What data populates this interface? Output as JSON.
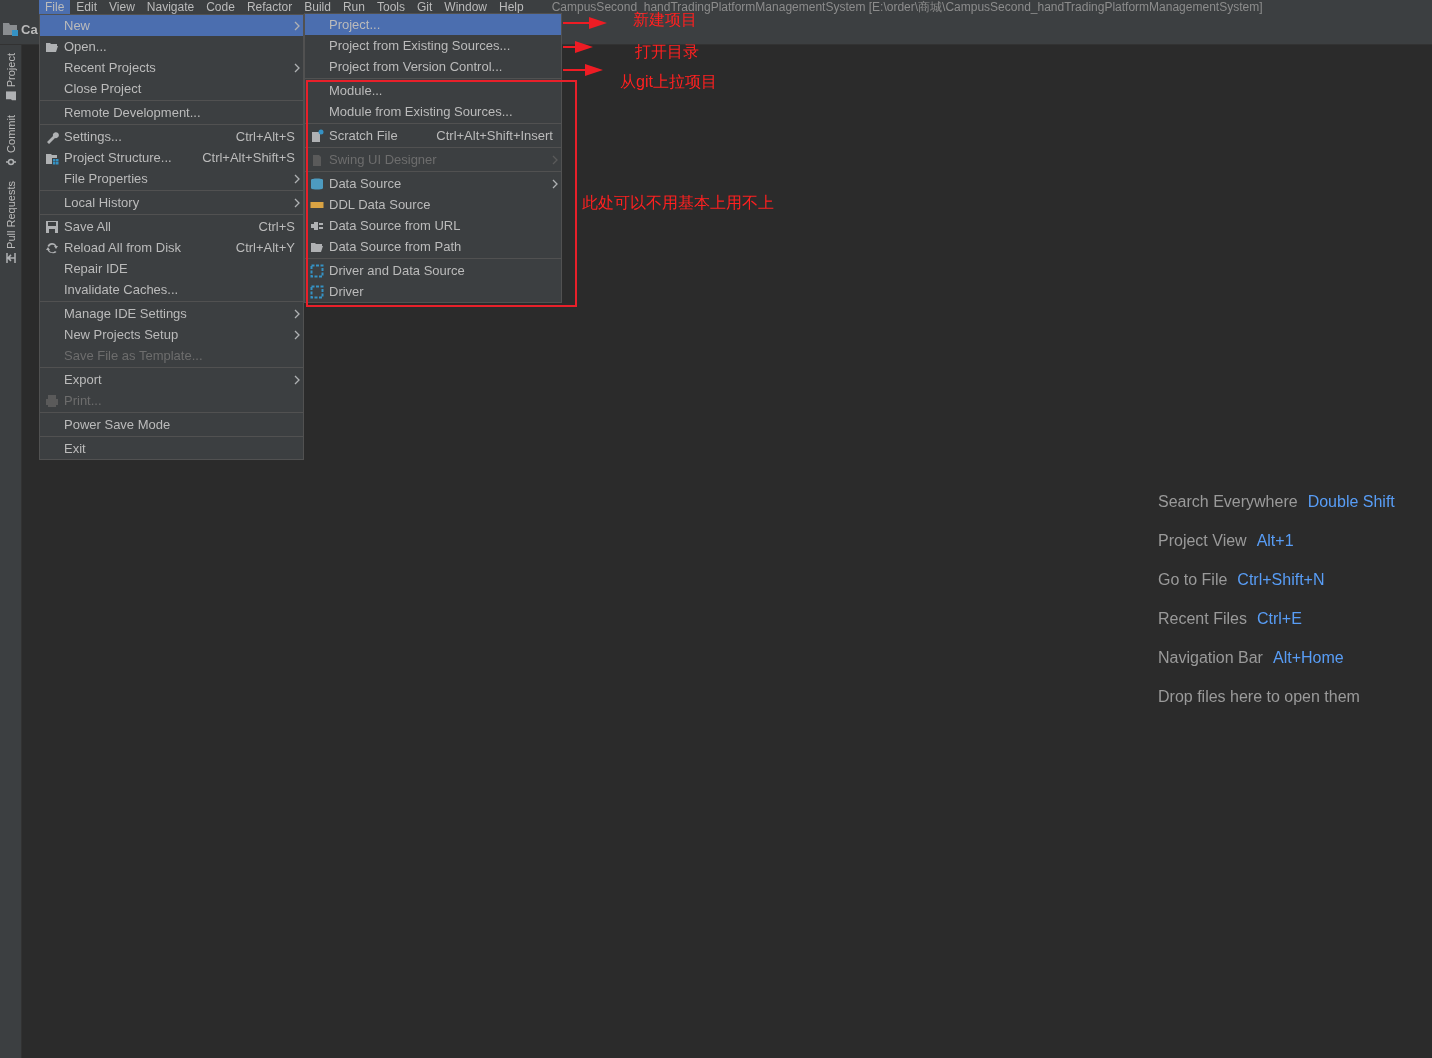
{
  "menu_bar": [
    {
      "label": "File",
      "selected": true
    },
    {
      "label": "Edit",
      "selected": false
    },
    {
      "label": "View",
      "selected": false
    },
    {
      "label": "Navigate",
      "selected": false
    },
    {
      "label": "Code",
      "selected": false
    },
    {
      "label": "Refactor",
      "selected": false
    },
    {
      "label": "Build",
      "selected": false
    },
    {
      "label": "Run",
      "selected": false
    },
    {
      "label": "Tools",
      "selected": false
    },
    {
      "label": "Git",
      "selected": false
    },
    {
      "label": "Window",
      "selected": false
    },
    {
      "label": "Help",
      "selected": false
    }
  ],
  "window": {
    "title": "CampusSecond_handTradingPlatformManagementSystem [E:\\order\\商城\\CampusSecond_handTradingPlatformManagementSystem]"
  },
  "project_label": "Ca",
  "tool_window_tabs": [
    {
      "label": "Project",
      "kind": "folder"
    },
    {
      "label": "Commit",
      "kind": "commit"
    },
    {
      "label": "Pull Requests",
      "kind": "pull"
    }
  ],
  "file_menu": [
    {
      "kind": "item",
      "label": "New",
      "submenu": true,
      "selected": true,
      "disabled": false
    },
    {
      "kind": "open",
      "label": "Open...",
      "selected": false,
      "disabled": false
    },
    {
      "kind": "item",
      "label": "Recent Projects",
      "submenu": true,
      "selected": false,
      "disabled": false
    },
    {
      "kind": "item",
      "label": "Close Project",
      "selected": false,
      "disabled": false
    },
    {
      "kind": "separator"
    },
    {
      "kind": "item",
      "label": "Remote Development...",
      "selected": false,
      "disabled": false
    },
    {
      "kind": "separator"
    },
    {
      "kind": "settings",
      "label": "Settings...",
      "shortcut": "Ctrl+Alt+S",
      "selected": false,
      "disabled": false
    },
    {
      "kind": "structure",
      "label": "Project Structure...",
      "shortcut": "Ctrl+Alt+Shift+S",
      "selected": false,
      "disabled": false
    },
    {
      "kind": "item",
      "label": "File Properties",
      "submenu": true,
      "selected": false,
      "disabled": false
    },
    {
      "kind": "separator"
    },
    {
      "kind": "item",
      "label": "Local History",
      "submenu": true,
      "selected": false,
      "disabled": false
    },
    {
      "kind": "separator"
    },
    {
      "kind": "save",
      "label": "Save All",
      "shortcut": "Ctrl+S",
      "selected": false,
      "disabled": false
    },
    {
      "kind": "reload",
      "label": "Reload All from Disk",
      "shortcut": "Ctrl+Alt+Y",
      "selected": false,
      "disabled": false
    },
    {
      "kind": "item",
      "label": "Repair IDE",
      "selected": false,
      "disabled": false
    },
    {
      "kind": "item",
      "label": "Invalidate Caches...",
      "selected": false,
      "disabled": false
    },
    {
      "kind": "separator"
    },
    {
      "kind": "item",
      "label": "Manage IDE Settings",
      "submenu": true,
      "selected": false,
      "disabled": false
    },
    {
      "kind": "item",
      "label": "New Projects Setup",
      "submenu": true,
      "selected": false,
      "disabled": false
    },
    {
      "kind": "item",
      "label": "Save File as Template...",
      "selected": false,
      "disabled": true
    },
    {
      "kind": "separator"
    },
    {
      "kind": "item",
      "label": "Export",
      "submenu": true,
      "selected": false,
      "disabled": false
    },
    {
      "kind": "print",
      "label": "Print...",
      "selected": false,
      "disabled": true
    },
    {
      "kind": "separator"
    },
    {
      "kind": "item",
      "label": "Power Save Mode",
      "selected": false,
      "disabled": false
    },
    {
      "kind": "separator"
    },
    {
      "kind": "item",
      "label": "Exit",
      "selected": false,
      "disabled": false
    }
  ],
  "new_submenu": [
    {
      "kind": "item",
      "label": "Project...",
      "selected": true,
      "disabled": false
    },
    {
      "kind": "item",
      "label": "Project from Existing Sources...",
      "selected": false,
      "disabled": false
    },
    {
      "kind": "item",
      "label": "Project from Version Control...",
      "selected": false,
      "disabled": false
    },
    {
      "kind": "separator"
    },
    {
      "kind": "item",
      "label": "Module...",
      "selected": false,
      "disabled": false
    },
    {
      "kind": "item",
      "label": "Module from Existing Sources...",
      "selected": false,
      "disabled": false
    },
    {
      "kind": "separator"
    },
    {
      "kind": "scratch",
      "label": "Scratch File",
      "shortcut": "Ctrl+Alt+Shift+Insert",
      "selected": false,
      "disabled": false
    },
    {
      "kind": "separator"
    },
    {
      "kind": "swing",
      "label": "Swing UI Designer",
      "submenu": true,
      "selected": false,
      "disabled": true
    },
    {
      "kind": "separator"
    },
    {
      "kind": "database",
      "label": "Data Source",
      "submenu": true,
      "selected": false,
      "disabled": false
    },
    {
      "kind": "ddl",
      "label": "DDL Data Source",
      "selected": false,
      "disabled": false
    },
    {
      "kind": "url",
      "label": "Data Source from URL",
      "selected": false,
      "disabled": false
    },
    {
      "kind": "path",
      "label": "Data Source from Path",
      "selected": false,
      "disabled": false
    },
    {
      "kind": "separator"
    },
    {
      "kind": "driver",
      "label": "Driver and Data Source",
      "selected": false,
      "disabled": false
    },
    {
      "kind": "driver",
      "label": "Driver",
      "selected": false,
      "disabled": false
    }
  ],
  "annotations": [
    {
      "text": "新建项目"
    },
    {
      "text": "打开目录"
    },
    {
      "text": "从git上拉项目"
    },
    {
      "text": "此处可以不用基本上用不上"
    }
  ],
  "welcome_hints": [
    {
      "label": "Search Everywhere",
      "shortcut": "Double Shift"
    },
    {
      "label": "Project View",
      "shortcut": "Alt+1"
    },
    {
      "label": "Go to File",
      "shortcut": "Ctrl+Shift+N"
    },
    {
      "label": "Recent Files",
      "shortcut": "Ctrl+E"
    },
    {
      "label": "Navigation Bar",
      "shortcut": "Alt+Home"
    },
    {
      "label": "Drop files here to open them"
    }
  ]
}
